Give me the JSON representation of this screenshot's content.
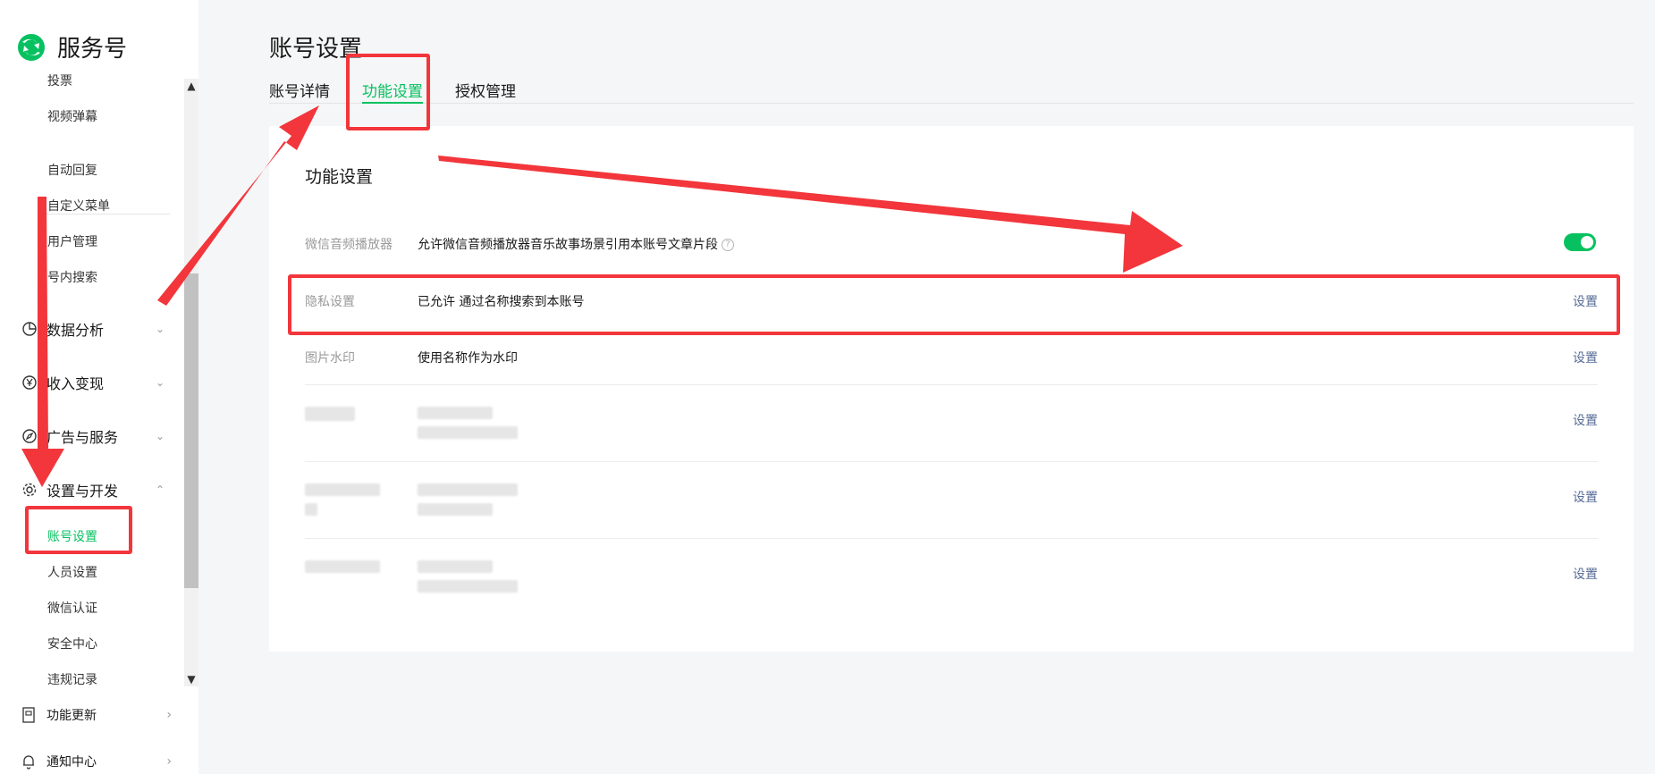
{
  "brand": {
    "name": "服务号"
  },
  "sidebar": {
    "top_items": [
      {
        "label": "投票"
      },
      {
        "label": "视频弹幕"
      },
      {
        "label": "自动回复"
      },
      {
        "label": "自定义菜单"
      },
      {
        "label": "用户管理"
      },
      {
        "label": "号内搜索"
      }
    ],
    "groups": [
      {
        "label": "数据分析",
        "icon": "chart-icon",
        "expanded": false
      },
      {
        "label": "收入变现",
        "icon": "yen-icon",
        "expanded": false
      },
      {
        "label": "广告与服务",
        "icon": "compass-icon",
        "expanded": false
      },
      {
        "label": "设置与开发",
        "icon": "gear-icon",
        "expanded": true
      }
    ],
    "settings_items": [
      {
        "label": "账号设置",
        "active": true
      },
      {
        "label": "人员设置"
      },
      {
        "label": "微信认证"
      },
      {
        "label": "安全中心"
      },
      {
        "label": "违规记录"
      }
    ],
    "bottom_items": [
      {
        "label": "功能更新",
        "icon": "notebook-icon"
      },
      {
        "label": "通知中心",
        "icon": "bell-icon"
      }
    ]
  },
  "page": {
    "title": "账号设置"
  },
  "tabs": [
    {
      "label": "账号详情",
      "active": false
    },
    {
      "label": "功能设置",
      "active": true
    },
    {
      "label": "授权管理",
      "active": false
    }
  ],
  "card": {
    "title": "功能设置",
    "rows": [
      {
        "label": "微信音频播放器",
        "value": "允许微信音频播放器音乐故事场景引用本账号文章片段",
        "control": "toggle",
        "toggle_on": true
      },
      {
        "label": "隐私设置",
        "value": "已允许 通过名称搜索到本账号",
        "link": "设置"
      },
      {
        "label": "图片水印",
        "value": "使用名称作为水印",
        "link": "设置"
      },
      {
        "label": "",
        "value": "",
        "link": "设置",
        "blurred": true
      },
      {
        "label": "",
        "value": "",
        "link": "设置",
        "blurred": true
      },
      {
        "label": "",
        "value": "",
        "link": "设置",
        "blurred": true
      }
    ]
  },
  "colors": {
    "accent": "#07c160",
    "link": "#576b95",
    "annotation": "#f2363b"
  }
}
